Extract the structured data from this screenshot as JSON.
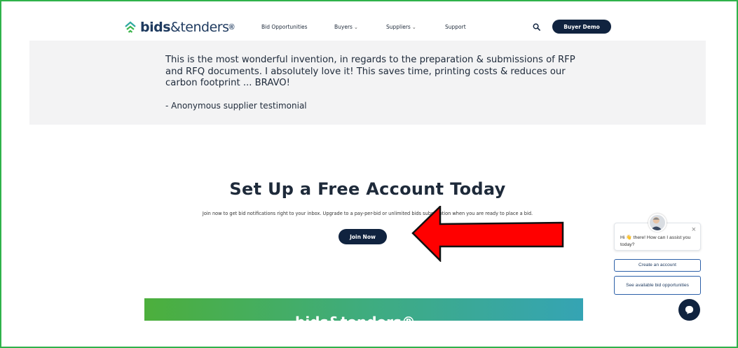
{
  "header": {
    "logo_bold": "bids",
    "logo_thin": "&tenders",
    "logo_reg": "®",
    "nav": [
      {
        "label": "Bid Opportunities",
        "has_dropdown": false
      },
      {
        "label": "Buyers",
        "has_dropdown": true
      },
      {
        "label": "Suppliers",
        "has_dropdown": true
      },
      {
        "label": "Support",
        "has_dropdown": false
      }
    ],
    "demo_button": "Buyer Demo",
    "search_icon": "search-icon"
  },
  "testimonial": {
    "quote": "This is the most wonderful invention, in regards to the preparation & submissions of RFP and RFQ documents. I absolutely love it! This saves time, printing costs & reduces our carbon footprint ... BRAVO!",
    "attribution": "- Anonymous supplier testimonial"
  },
  "cta": {
    "title": "Set Up a Free Account Today",
    "subtitle": "Join now to get bid notifications right to your inbox. Upgrade to a pay-per-bid or unlimited bids subscription when you are ready to place a bid.",
    "button": "Join Now"
  },
  "banner": {
    "text": "bids&tenders®"
  },
  "chat": {
    "message": "Hi 👋 there! How can I assist you today?",
    "close": "×",
    "options": [
      "Create an account",
      "See available bid opportunities"
    ]
  },
  "colors": {
    "frame_border": "#2fb24a",
    "navy": "#10233f",
    "arrow_red": "#ff0000",
    "testimonial_bg": "#f3f3f4"
  }
}
